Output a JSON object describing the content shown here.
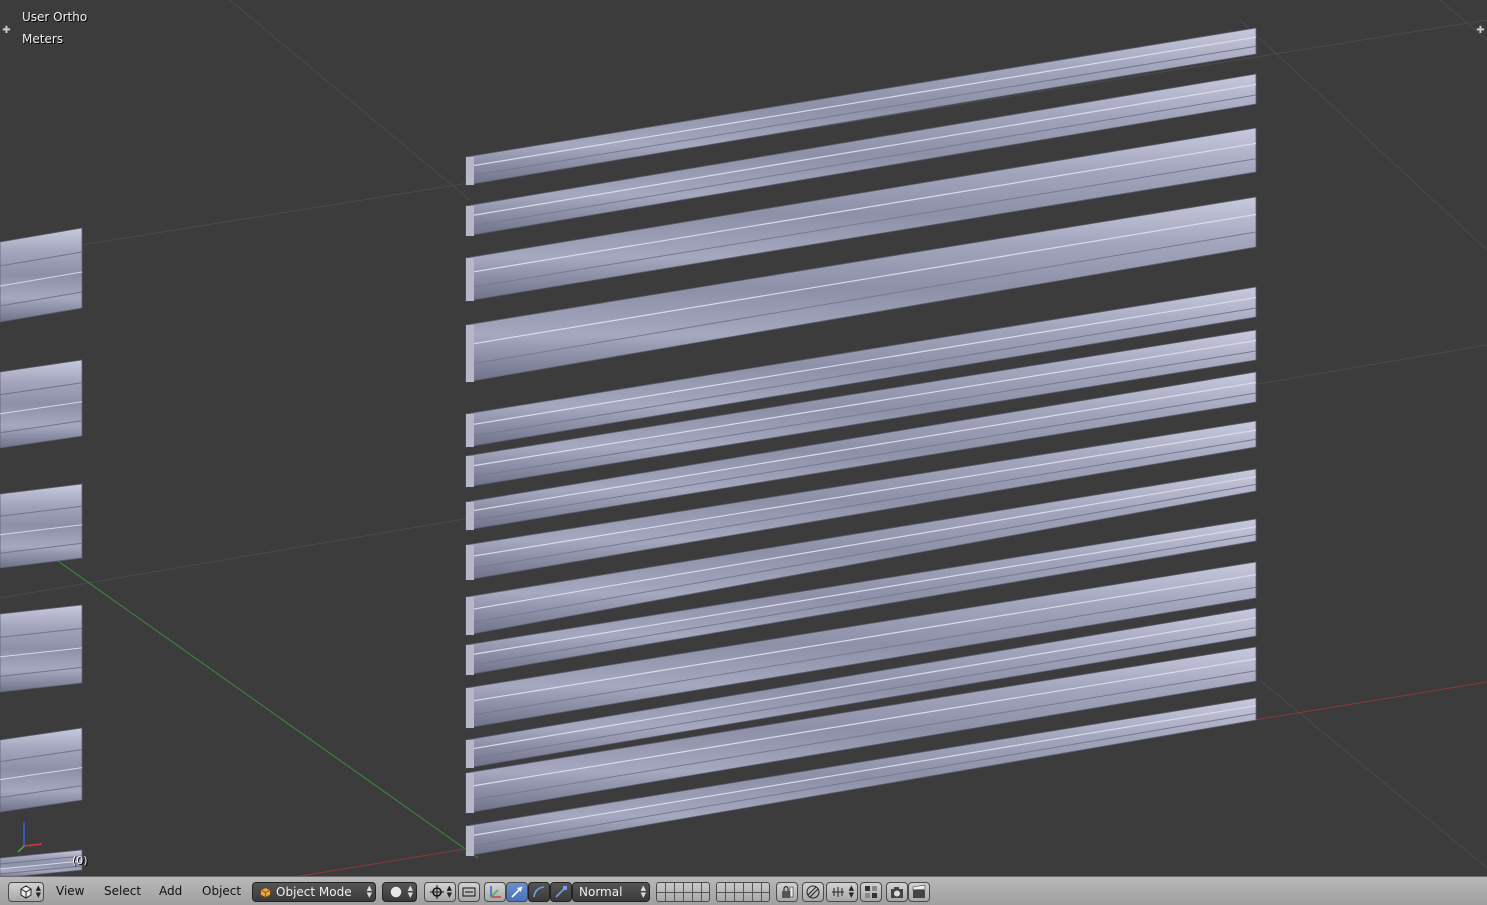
{
  "viewport": {
    "view_name": "User Ortho",
    "units": "Meters",
    "frame": "(0)"
  },
  "header": {
    "editor_type_icon": "3d-view-icon",
    "menus": [
      "View",
      "Select",
      "Add",
      "Object"
    ],
    "mode": "Object Mode",
    "viewport_shading_icon": "solid-sphere-icon",
    "pivot_icon": "pivot-point-icon",
    "transform_orientation": "Normal"
  },
  "colors": {
    "viewport_bg": "#3c3c3c",
    "mesh": "#9ea0b8",
    "x_axis": "#8a3a3a",
    "y_axis": "#3d8a3d",
    "header_bg": "#a9a9a9"
  }
}
